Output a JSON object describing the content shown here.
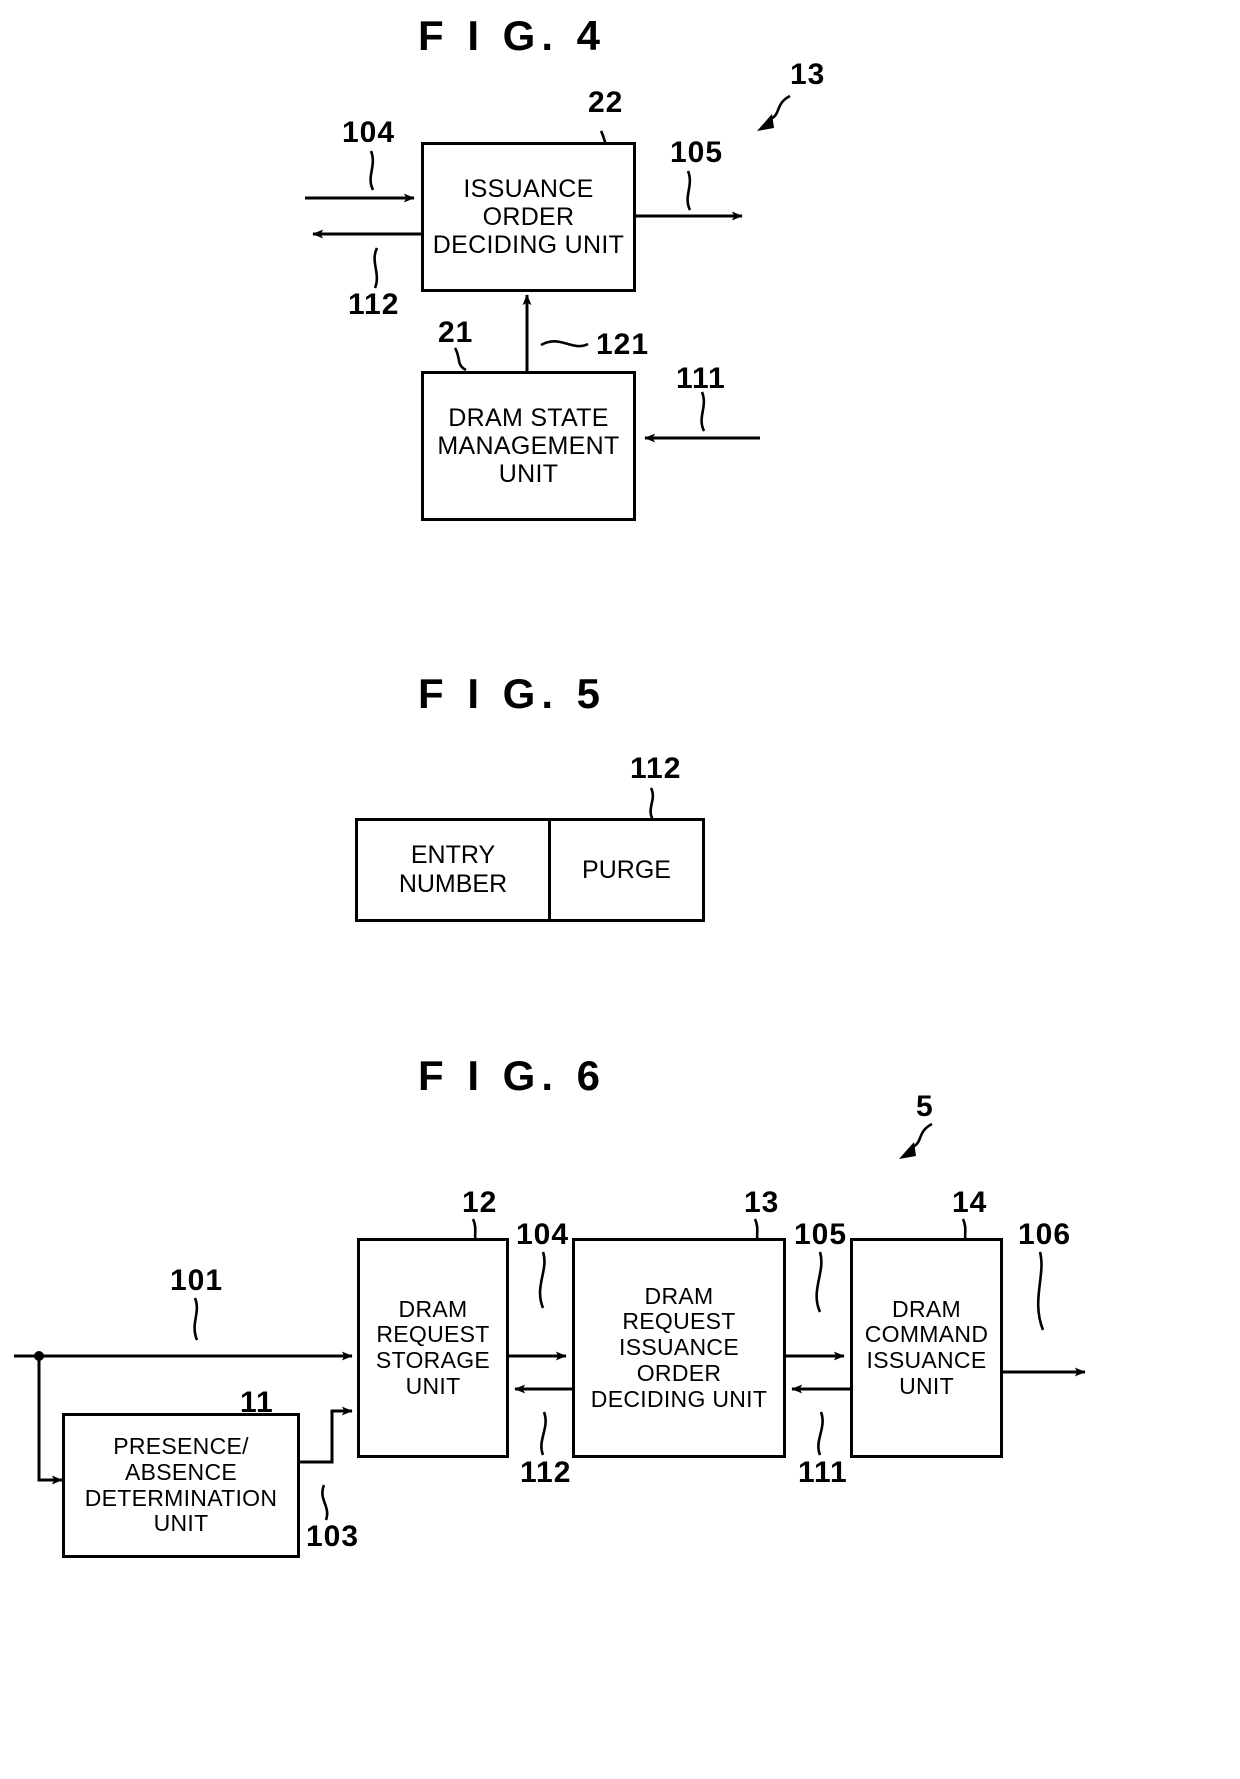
{
  "figures": [
    {
      "id": "fig4",
      "title": "F I G.  4",
      "overall_ref": "13",
      "boxes": [
        {
          "ref": "22",
          "lines": [
            "ISSUANCE",
            "ORDER",
            "DECIDING UNIT"
          ]
        },
        {
          "ref": "21",
          "lines": [
            "DRAM STATE",
            "MANAGEMENT",
            "UNIT"
          ]
        }
      ],
      "signals": [
        "104",
        "112",
        "105",
        "121",
        "111"
      ]
    },
    {
      "id": "fig5",
      "title": "F I G.  5",
      "table_ref": "112",
      "table": {
        "columns": [
          "ENTRY\nNUMBER",
          "PURGE"
        ],
        "cells": [
          {
            "lines": [
              "ENTRY",
              "NUMBER"
            ]
          },
          {
            "lines": [
              "PURGE"
            ]
          }
        ]
      }
    },
    {
      "id": "fig6",
      "title": "F I G.  6",
      "overall_ref": "5",
      "boxes": [
        {
          "ref": "11",
          "lines": [
            "PRESENCE/",
            "ABSENCE",
            "DETERMINATION",
            "UNIT"
          ]
        },
        {
          "ref": "12",
          "lines": [
            "DRAM",
            "REQUEST",
            "STORAGE",
            "UNIT"
          ]
        },
        {
          "ref": "13",
          "lines": [
            "DRAM",
            "REQUEST",
            "ISSUANCE",
            "ORDER",
            "DECIDING UNIT"
          ]
        },
        {
          "ref": "14",
          "lines": [
            "DRAM",
            "COMMAND",
            "ISSUANCE",
            "UNIT"
          ]
        }
      ],
      "signals": [
        "101",
        "103",
        "104",
        "105",
        "106",
        "111",
        "112"
      ]
    }
  ]
}
